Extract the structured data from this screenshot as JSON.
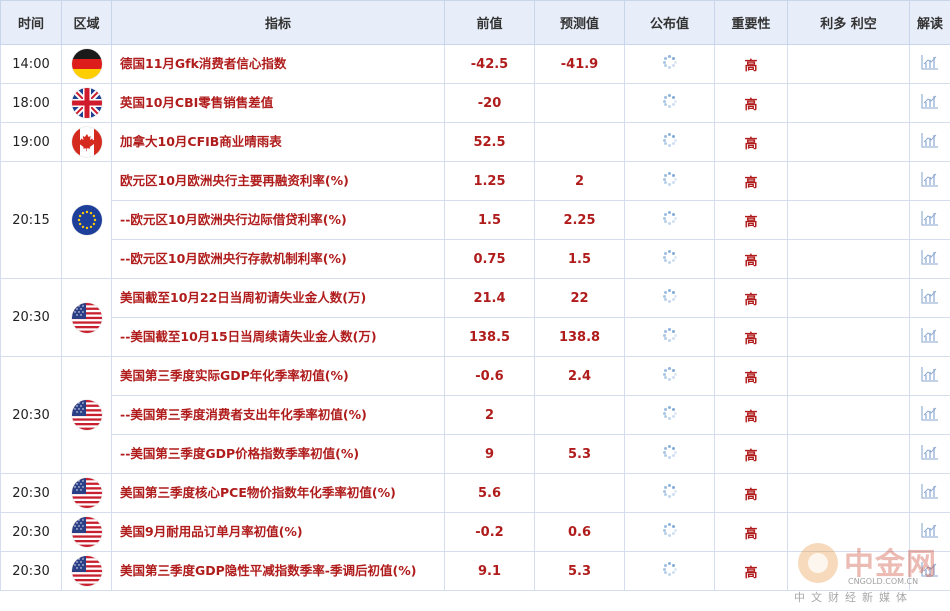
{
  "headers": {
    "time": "时间",
    "region": "区域",
    "indicator": "指标",
    "previous": "前值",
    "forecast": "预测值",
    "actual": "公布值",
    "importance": "重要性",
    "impact": "利多 利空",
    "analysis": "解读"
  },
  "groups": [
    {
      "time": "14:00",
      "flag": "germany",
      "rows": [
        {
          "indicator": "德国11月Gfk消费者信心指数",
          "previous": "-42.5",
          "forecast": "-41.9",
          "importance": "高"
        }
      ]
    },
    {
      "time": "18:00",
      "flag": "uk",
      "rows": [
        {
          "indicator": "英国10月CBI零售销售差值",
          "previous": "-20",
          "forecast": "",
          "importance": "高"
        }
      ]
    },
    {
      "time": "19:00",
      "flag": "canada",
      "rows": [
        {
          "indicator": "加拿大10月CFIB商业晴雨表",
          "previous": "52.5",
          "forecast": "",
          "importance": "高"
        }
      ]
    },
    {
      "time": "20:15",
      "flag": "eu",
      "rows": [
        {
          "indicator": "欧元区10月欧洲央行主要再融资利率(%)",
          "previous": "1.25",
          "forecast": "2",
          "importance": "高"
        },
        {
          "indicator": "--欧元区10月欧洲央行边际借贷利率(%)",
          "previous": "1.5",
          "forecast": "2.25",
          "importance": "高"
        },
        {
          "indicator": "--欧元区10月欧洲央行存款机制利率(%)",
          "previous": "0.75",
          "forecast": "1.5",
          "importance": "高"
        }
      ]
    },
    {
      "time": "20:30",
      "flag": "usa",
      "rows": [
        {
          "indicator": "美国截至10月22日当周初请失业金人数(万)",
          "previous": "21.4",
          "forecast": "22",
          "importance": "高"
        },
        {
          "indicator": "--美国截至10月15日当周续请失业金人数(万)",
          "previous": "138.5",
          "forecast": "138.8",
          "importance": "高"
        }
      ]
    },
    {
      "time": "20:30",
      "flag": "usa",
      "rows": [
        {
          "indicator": "美国第三季度实际GDP年化季率初值(%)",
          "previous": "-0.6",
          "forecast": "2.4",
          "importance": "高"
        },
        {
          "indicator": "--美国第三季度消费者支出年化季率初值(%)",
          "previous": "2",
          "forecast": "",
          "importance": "高"
        },
        {
          "indicator": "--美国第三季度GDP价格指数季率初值(%)",
          "previous": "9",
          "forecast": "5.3",
          "importance": "高"
        }
      ]
    },
    {
      "time": "20:30",
      "flag": "usa",
      "rows": [
        {
          "indicator": "美国第三季度核心PCE物价指数年化季率初值(%)",
          "previous": "5.6",
          "forecast": "",
          "importance": "高"
        }
      ]
    },
    {
      "time": "20:30",
      "flag": "usa",
      "rows": [
        {
          "indicator": "美国9月耐用品订单月率初值(%)",
          "previous": "-0.2",
          "forecast": "0.6",
          "importance": "高"
        }
      ]
    },
    {
      "time": "20:30",
      "flag": "usa",
      "rows": [
        {
          "indicator": "美国第三季度GDP隐性平减指数季率-季调后初值(%)",
          "previous": "9.1",
          "forecast": "5.3",
          "importance": "高"
        }
      ]
    }
  ],
  "icons": {
    "actual_pending": "loading-spinner-icon",
    "analysis": "bar-chart-icon"
  },
  "colors": {
    "header_bg": "#e8eef9",
    "value_red": "#b01c1c",
    "border": "#d5deee"
  },
  "watermark": {
    "brand": "中金网",
    "domain": "CNGOLD.COM.CN",
    "tagline": "中文财经新媒体"
  }
}
